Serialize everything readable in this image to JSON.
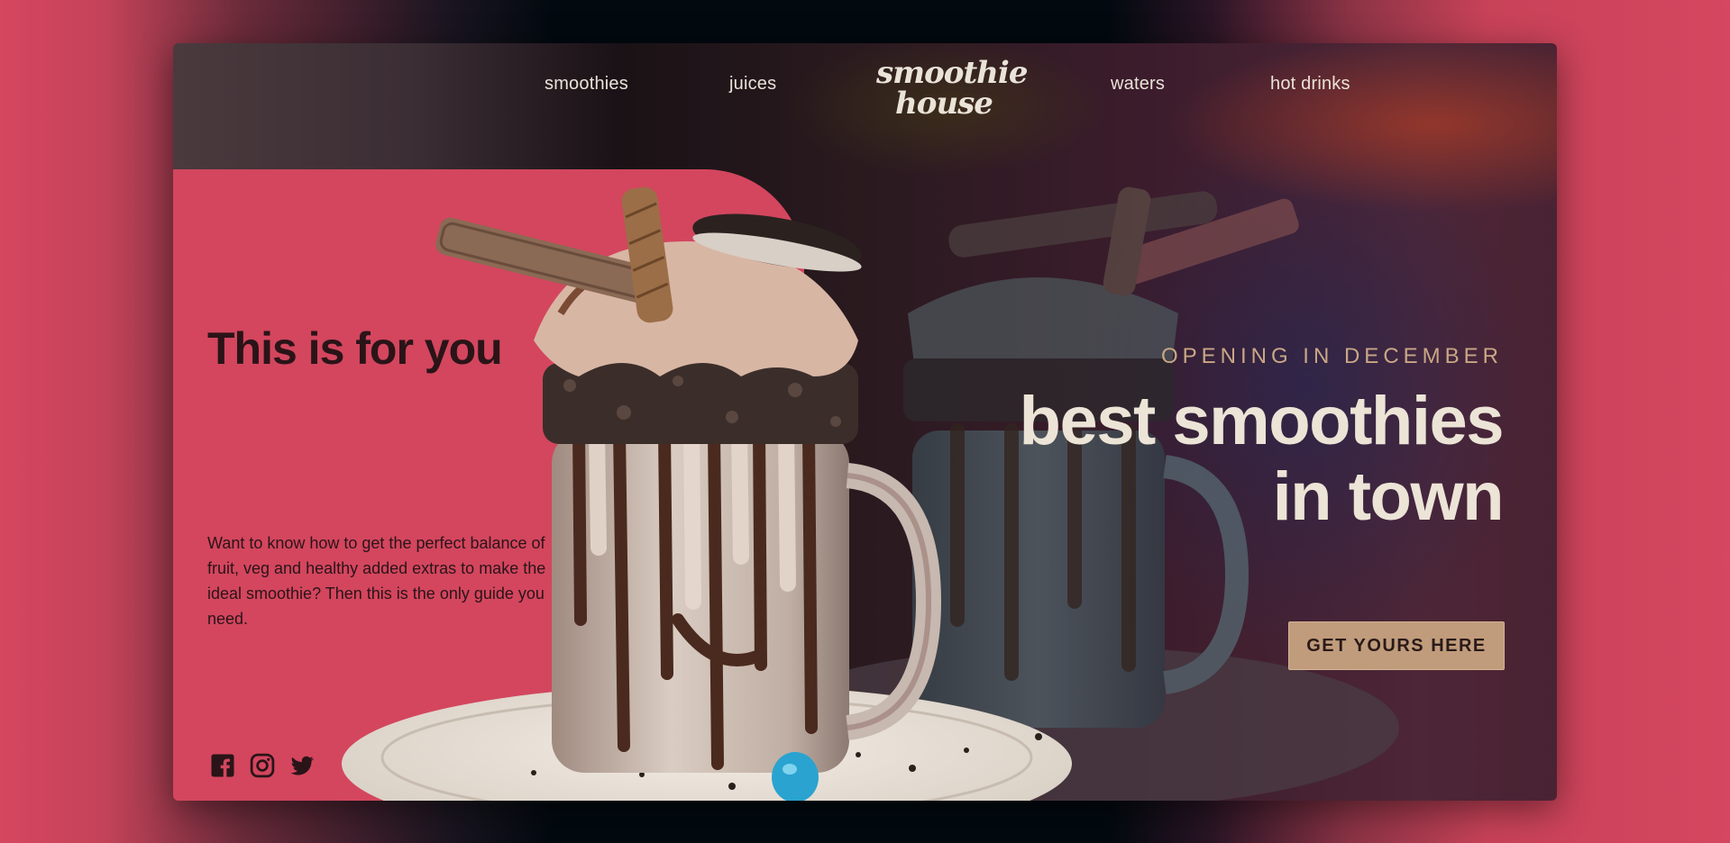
{
  "nav": {
    "links": [
      {
        "label": "smoothies"
      },
      {
        "label": "juices"
      },
      {
        "label": "waters"
      },
      {
        "label": "hot drinks"
      }
    ],
    "logo": {
      "line1": "smoothie",
      "line2": "house"
    }
  },
  "left": {
    "title": "This is for you",
    "description": "Want to know how to get the perfect balance of fruit, veg and healthy added extras to make the ideal smoothie? Then this is the only guide you need."
  },
  "social": {
    "icons": [
      "facebook-icon",
      "instagram-icon",
      "twitter-icon"
    ]
  },
  "hero": {
    "eyebrow": "OPENING IN DECEMBER",
    "headline_line1": "best smoothies",
    "headline_line2": "in town",
    "cta_label": "GET YOURS HERE"
  },
  "colors": {
    "accent_pink": "#d3465e",
    "cta_tan": "#c09c7c",
    "text_light": "#ece4d6",
    "text_dark": "#2a1418"
  }
}
